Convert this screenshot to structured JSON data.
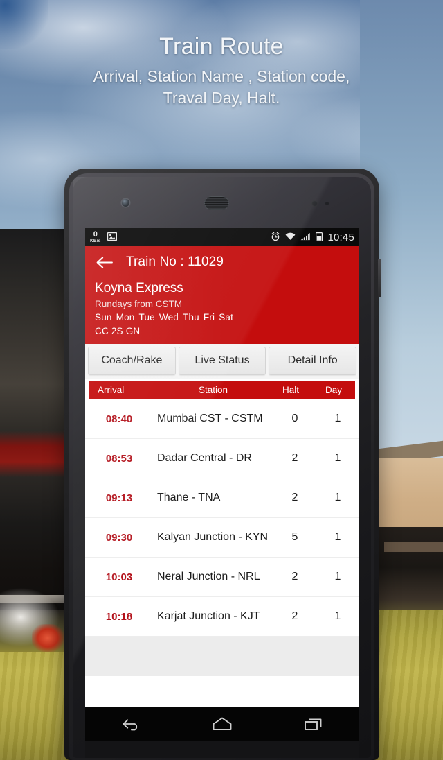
{
  "promo": {
    "headline": "Train Route",
    "subline_1": "Arrival, Station Name , Station code,",
    "subline_2": "Traval Day, Halt."
  },
  "status_bar": {
    "net_speed_value": "0",
    "net_speed_unit": "KB/s",
    "image_icon": "image-icon",
    "alarm_icon": "alarm-icon",
    "wifi_icon": "wifi-icon",
    "signal_icon": "signal-icon",
    "battery_icon": "battery-icon",
    "clock": "10:45"
  },
  "app_bar": {
    "back_icon": "back-arrow-icon",
    "title": "Train No : 11029",
    "train_name": "Koyna Express",
    "rundays_label": "Rundays from CSTM",
    "days": [
      "Sun",
      "Mon",
      "Tue",
      "Wed",
      "Thu",
      "Fri",
      "Sat"
    ],
    "classes": "CC 2S GN",
    "background_color": "#c40d0d"
  },
  "tabs": [
    {
      "label": "Coach/Rake"
    },
    {
      "label": "Live Status"
    },
    {
      "label": "Detail Info"
    }
  ],
  "route_table": {
    "headers": {
      "arrival": "Arrival",
      "station": "Station",
      "halt": "Halt",
      "day": "Day"
    },
    "header_color": "#c40d0d",
    "arrival_text_color": "#b3121b",
    "rows": [
      {
        "arrival": "08:40",
        "station": "Mumbai CST - CSTM",
        "halt": "0",
        "day": "1"
      },
      {
        "arrival": "08:53",
        "station": "Dadar Central - DR",
        "halt": "2",
        "day": "1"
      },
      {
        "arrival": "09:13",
        "station": "Thane - TNA",
        "halt": "2",
        "day": "1"
      },
      {
        "arrival": "09:30",
        "station": "Kalyan Junction - KYN",
        "halt": "5",
        "day": "1"
      },
      {
        "arrival": "10:03",
        "station": "Neral Junction - NRL",
        "halt": "2",
        "day": "1"
      },
      {
        "arrival": "10:18",
        "station": "Karjat Junction - KJT",
        "halt": "2",
        "day": "1"
      }
    ]
  },
  "nav_bar": {
    "back": "android-back-icon",
    "home": "android-home-icon",
    "recents": "android-recents-icon"
  }
}
